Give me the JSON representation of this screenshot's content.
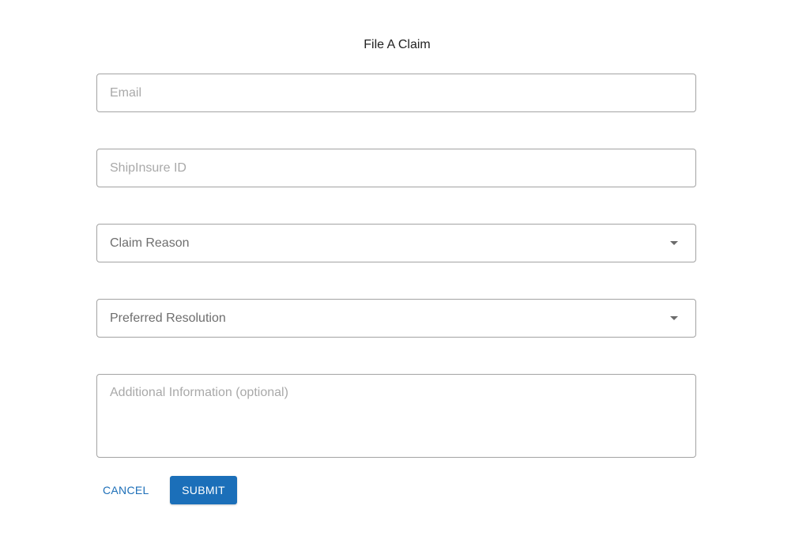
{
  "form": {
    "title": "File A Claim",
    "email": {
      "placeholder": "Email",
      "value": ""
    },
    "shipinsure_id": {
      "placeholder": "ShipInsure ID",
      "value": ""
    },
    "claim_reason": {
      "label": "Claim Reason",
      "icon": "chevron-down-icon"
    },
    "preferred_resolution": {
      "label": "Preferred Resolution",
      "icon": "chevron-down-icon"
    },
    "additional_info": {
      "placeholder": "Additional Information (optional)",
      "value": ""
    }
  },
  "actions": {
    "cancel_label": "CANCEL",
    "submit_label": "SUBMIT"
  },
  "colors": {
    "accent": "#1b6fb9",
    "border": "#a3a3a3",
    "placeholder": "#a9a9a9"
  }
}
